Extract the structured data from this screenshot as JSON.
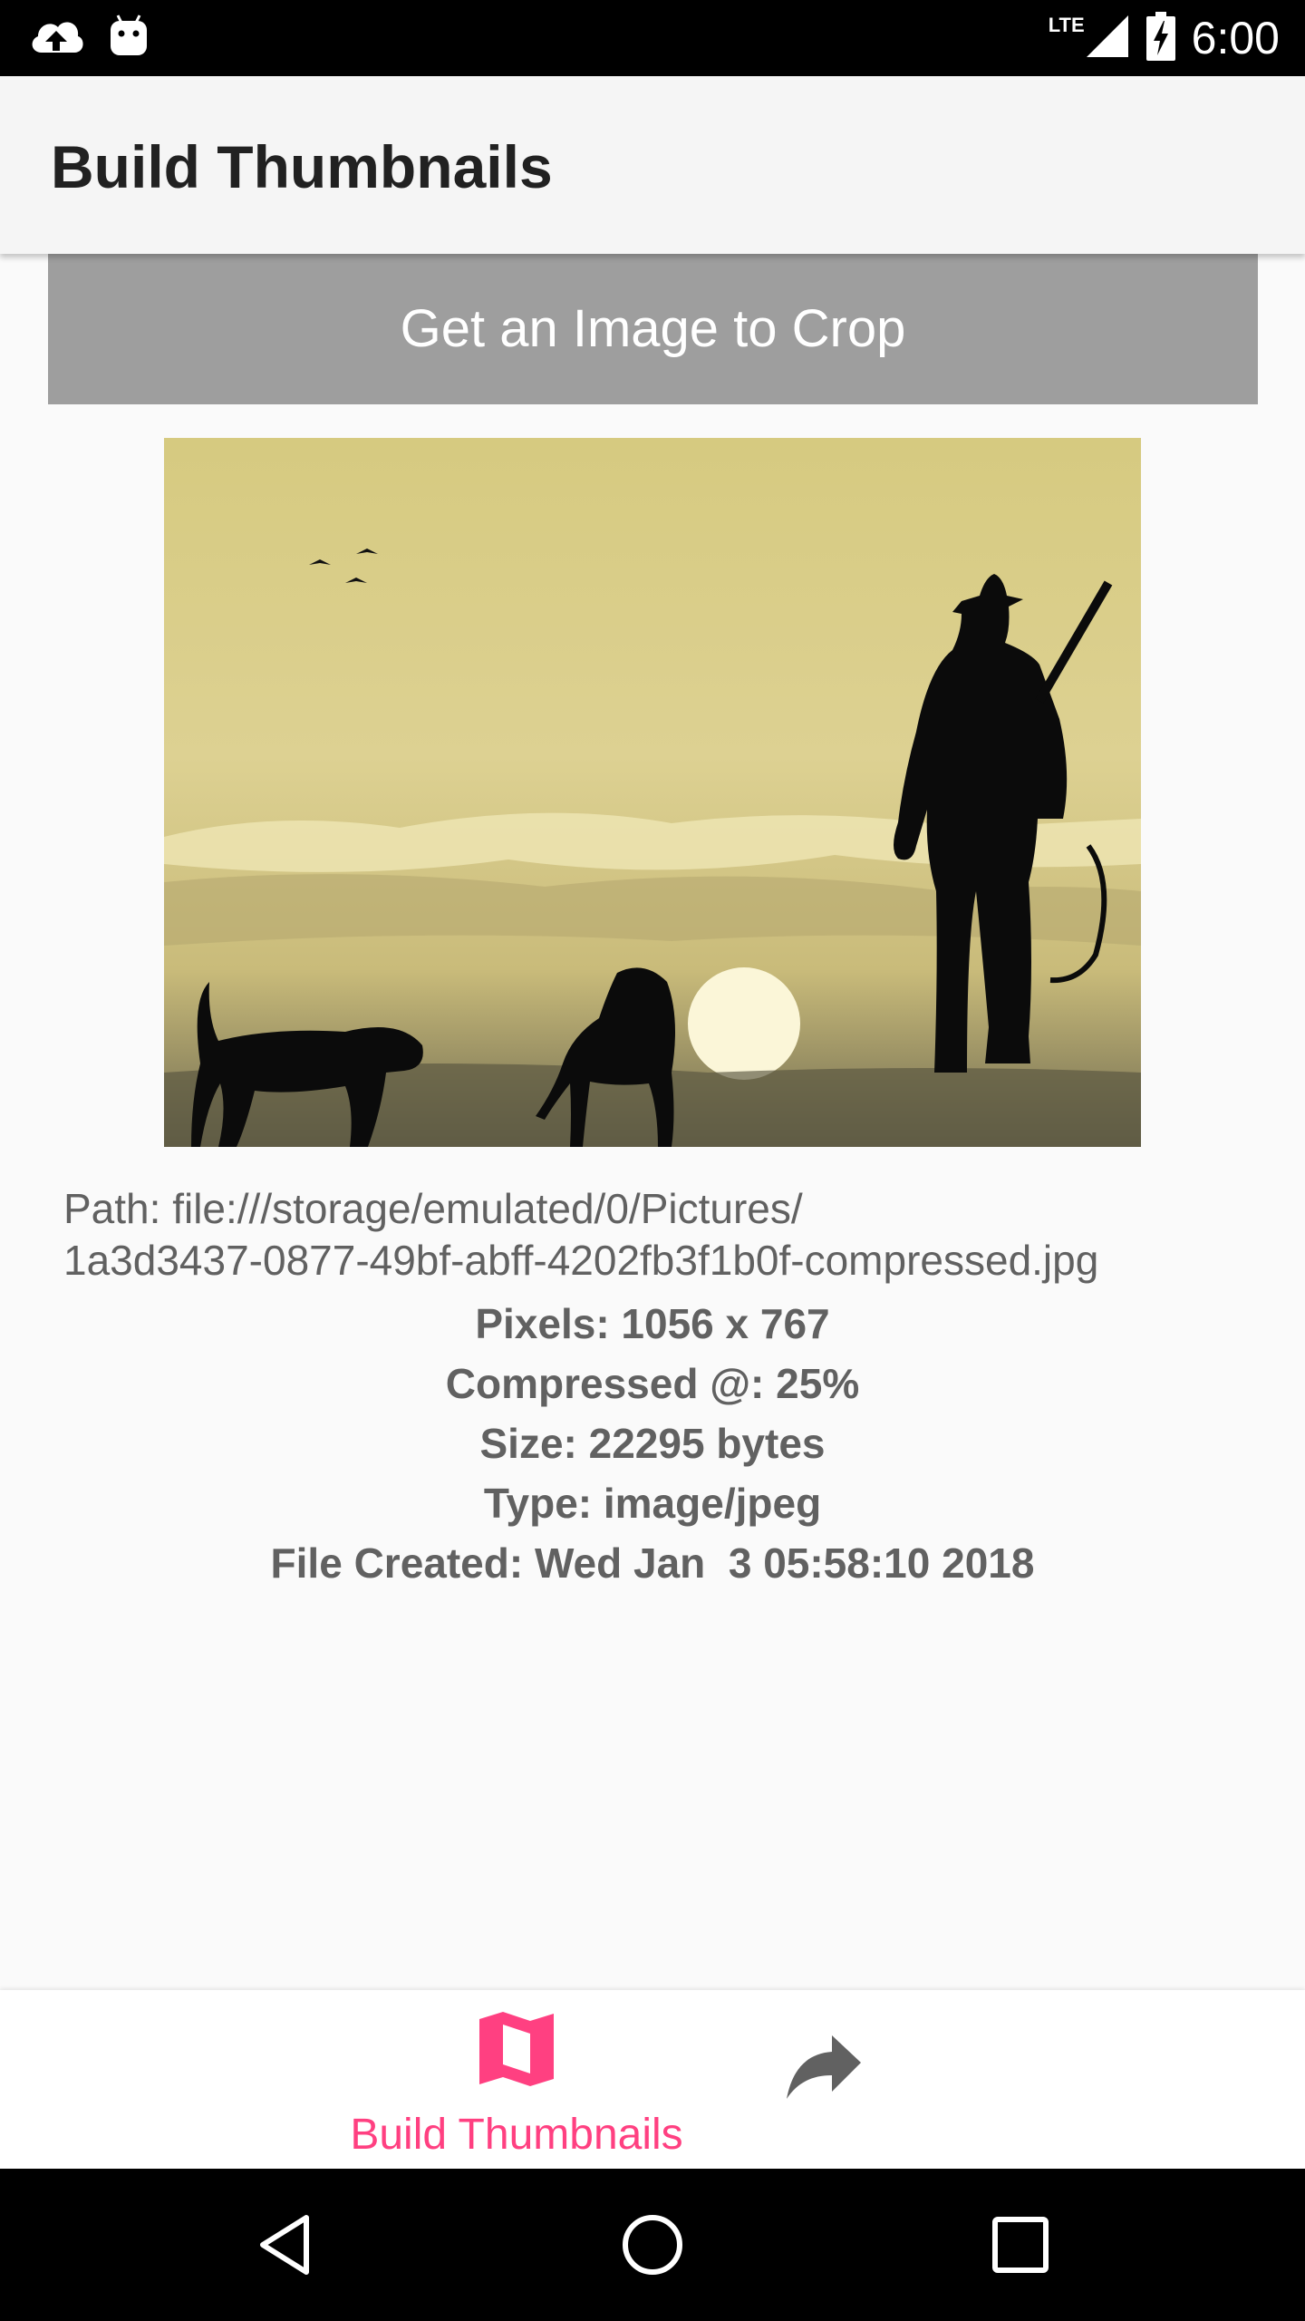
{
  "status_bar": {
    "time": "6:00",
    "network_label": "LTE",
    "icons": [
      "cloud-upload-icon",
      "android-icon",
      "signal-icon",
      "battery-charging-icon"
    ]
  },
  "app_bar": {
    "title": "Build Thumbnails"
  },
  "main": {
    "crop_button_label": "Get an Image to Crop",
    "image_description": "hunter-silhouette-sunset-photo",
    "info": {
      "path_line1": "Path: file:///storage/emulated/0/Pictures/",
      "path_line2": "1a3d3437-0877-49bf-abff-4202fb3f1b0f-compressed.jpg",
      "pixels": "Pixels: 1056 x 767",
      "compressed": "Compressed @: 25%",
      "size": "Size: 22295 bytes",
      "type": "Type: image/jpeg",
      "created": "File Created: Wed Jan  3 05:58:10 2018"
    }
  },
  "bottom_nav": {
    "items": [
      {
        "label": "Build Thumbnails",
        "icon": "map-icon",
        "active": true
      },
      {
        "label": "",
        "icon": "share-icon",
        "active": false
      }
    ],
    "colors": {
      "active": "#ff4081",
      "inactive": "#616161"
    }
  },
  "system_nav": {
    "buttons": [
      "back-icon",
      "home-icon",
      "recents-icon"
    ]
  },
  "colors": {
    "crop_button": "#9e9e9e",
    "accent": "#ff4081",
    "app_bar": "#f5f5f5"
  }
}
